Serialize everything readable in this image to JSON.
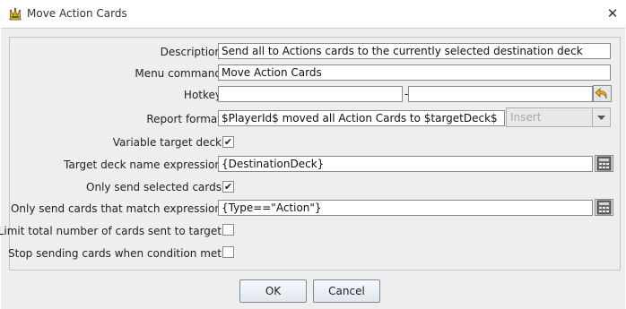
{
  "window": {
    "title": "Move Action Cards",
    "close_icon": "close-icon",
    "app_icon": "jester-logo-icon"
  },
  "form": {
    "description": {
      "label": "Description",
      "value": "Send all to Actions cards to the currently selected destination deck"
    },
    "menu_command": {
      "label": "Menu command",
      "value": "Move Action Cards"
    },
    "hotkey": {
      "label": "Hotkey",
      "separator": "-",
      "value1": "",
      "value2": "",
      "reset_icon": "undo-arrow-icon"
    },
    "report_format": {
      "label": "Report format",
      "value": "$PlayerId$ moved all Action Cards to $targetDeck$",
      "insert_label": "Insert"
    },
    "variable_target_deck": {
      "label": "Variable target deck",
      "checked": true,
      "check_mark": "✔"
    },
    "target_deck_expression": {
      "label": "Target deck name expression",
      "value": "{DestinationDeck}",
      "calc_icon": "calculator-icon"
    },
    "only_selected": {
      "label": "Only send selected cards",
      "checked": true,
      "check_mark": "✔"
    },
    "match_expression": {
      "label": "Only send cards that match expression",
      "value": "{Type==\"Action\"}",
      "calc_icon": "calculator-icon"
    },
    "limit_total": {
      "label": "Limit total number of cards sent to target",
      "checked": false,
      "check_mark": ""
    },
    "stop_when": {
      "label": "Stop sending cards when condition met",
      "checked": false,
      "check_mark": ""
    }
  },
  "buttons": {
    "ok": "OK",
    "cancel": "Cancel"
  }
}
